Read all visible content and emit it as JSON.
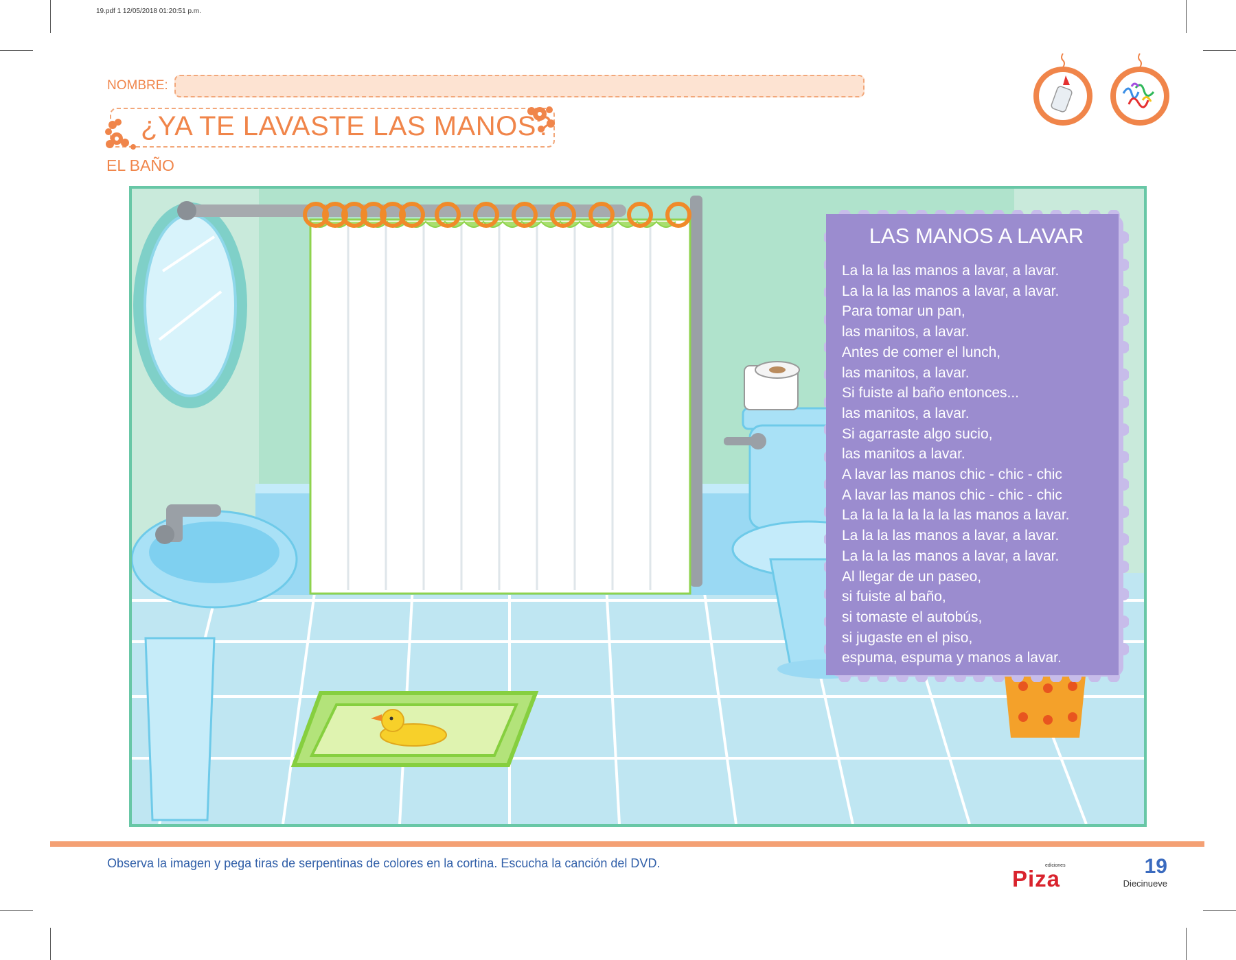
{
  "print_info": "19.pdf   1   12/05/2018   01:20:51 p.m.",
  "header": {
    "name_label": "NOMBRE:",
    "title": "¿YA TE LAVASTE LAS MANOS?",
    "subtitle": "EL BAÑO"
  },
  "badges": {
    "left_icon": "glue-bottle-icon",
    "right_icon": "streamers-icon"
  },
  "song": {
    "title": "LAS MANOS A LAVAR",
    "lines": [
      "La la la las manos a lavar, a lavar.",
      "La la la las manos a lavar, a lavar.",
      "Para tomar un pan,",
      "las manitos, a lavar.",
      "Antes de comer el lunch,",
      "las manitos, a lavar.",
      "Si fuiste al baño entonces...",
      "las manitos, a lavar.",
      "Si agarraste algo sucio,",
      "las manitos a lavar.",
      "A lavar las manos chic - chic - chic",
      "A lavar las manos chic - chic - chic",
      "La la la la la la la las manos a lavar.",
      "La la la las manos a lavar, a lavar.",
      "La la la las manos a lavar, a lavar.",
      "Al llegar de un paseo,",
      "si fuiste al baño,",
      "si tomaste el autobús,",
      "si jugaste en el piso,",
      "espuma, espuma y manos a lavar."
    ]
  },
  "footer": {
    "instruction": "Observa la imagen y pega tiras de serpentinas de colores en la cortina. Escucha la canción del DVD.",
    "publisher_small": "ediciones",
    "publisher": "Piza",
    "page_number": "19",
    "page_word": "Diecinueve"
  },
  "colors": {
    "orange": "#f0854a",
    "mint": "#68c7a6",
    "purple": "#9b8ccf",
    "blue_text": "#2f5ea8"
  }
}
